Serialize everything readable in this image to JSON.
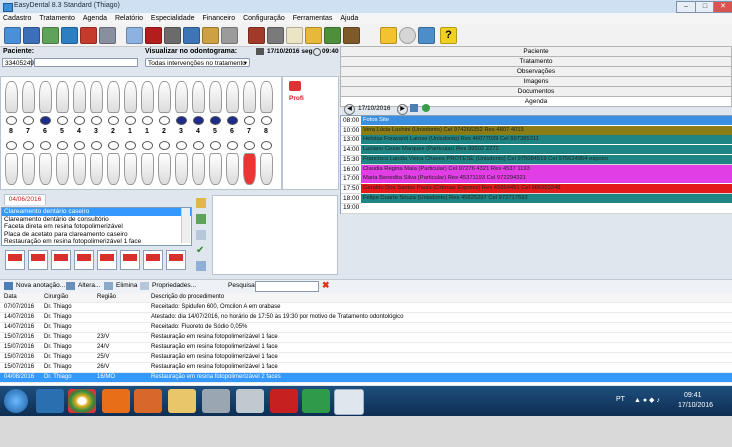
{
  "window": {
    "title": "EasyDental 8.3 Standard (Thiago)",
    "min": "–",
    "max": "□",
    "close": "✕"
  },
  "menu": [
    "Cadastro",
    "Tratamento",
    "Agenda",
    "Relatório",
    "Especialidade",
    "Financeiro",
    "Configuração",
    "Ferramentas",
    "Ajuda"
  ],
  "patient": {
    "label": "Paciente:",
    "id": "33405249",
    "name": ""
  },
  "view": {
    "label": "Visualizar no odontograma:",
    "value": "Todas intervenções no tratamento"
  },
  "header_date": {
    "date": "17/10/2016 seg",
    "time": "09:40"
  },
  "teeth_numbers": [
    "8",
    "7",
    "6",
    "5",
    "4",
    "3",
    "2",
    "1",
    "1",
    "2",
    "3",
    "4",
    "5",
    "6",
    "7",
    "8"
  ],
  "profile_label": "Profi",
  "right_tabs": [
    "Paciente",
    "Tratamento",
    "Observações",
    "Imagens",
    "Documentos",
    "Agenda"
  ],
  "agenda_date": "17/10/2016",
  "agenda": [
    {
      "time": "08:00",
      "text": "Fotos Site",
      "color": "#3b8fe0"
    },
    {
      "time": "10:00",
      "text": "Vera Lúcia Luchini (Unisdonto) Cel 974266352 Res 4807 4015",
      "color": "#8a7d16"
    },
    {
      "time": "13:00",
      "text": "Heloisa Foravanti Larose (Unisdonto) Res 46077039 Cel 997385311",
      "color": "#1f8484"
    },
    {
      "time": "14:00",
      "text": "Luciano Cezar Marques (Particular) Res 99502 2272",
      "color": "#1f8484"
    },
    {
      "time": "15:30",
      "text": "Francisca Landia Vieira Chaves PROTESE (Unisdonto) Cel 975084519 Cel 975624954 esposo",
      "color": "#1f8484"
    },
    {
      "time": "16:00",
      "text": "Claudia Regina Maia (Particular) Cel 97276 4321 Res 4537 1193",
      "color": "#e23ee6"
    },
    {
      "time": "17:00",
      "text": "Maria Benedita Silva (Particular) Res 45371193 Cel 972294321",
      "color": "#e23ee6"
    },
    {
      "time": "17:50",
      "text": "Geraldo Dos Santos Paulo (Ortonax Express) Res 45864451 Cel 986950248",
      "color": "#e31a1a"
    },
    {
      "time": "18:00",
      "text": "Felipe Duarte Souza (Unisdonto) Res 45825297 Cel 972717592",
      "color": "#1f8484"
    },
    {
      "time": "19:00",
      "text": "",
      "color": "#ffffff"
    }
  ],
  "treatment_tab": "04/06/2016",
  "procedures": [
    "Clareamento dentário caseiro",
    "Clareamento dentário de consultório",
    "Faceta direta em resina fotopolimerizável",
    "Placa de acetato para clareamento caseiro",
    "Restauração em resina fotopolimerizável 1 face"
  ],
  "actions": {
    "new": "Nova anotação...",
    "edit": "Altera...",
    "delete": "Elimina",
    "props": "Propriedades...",
    "search": "Pesquisa:"
  },
  "history_head": {
    "date": "Data",
    "surgeon": "Cirurgião",
    "region": "Região",
    "desc": "Descrição do procedimento"
  },
  "history": [
    {
      "date": "07/07/2016",
      "surgeon": "Dr. Thiago",
      "region": "",
      "desc": "Receitado: Spidufen 600, Omcilon A em orabase"
    },
    {
      "date": "14/07/2016",
      "surgeon": "Dr. Thiago",
      "region": "",
      "desc": "Atestado: dia 14/07/2016, no horário de 17:50 às 19:30 por motivo de Tratamento odontológico"
    },
    {
      "date": "14/07/2016",
      "surgeon": "Dr. Thiago",
      "region": "",
      "desc": "Receitado: Fluoreto de Sódio 0,05%"
    },
    {
      "date": "15/07/2016",
      "surgeon": "Dr. Thiago",
      "region": "23/V",
      "desc": "Restauração em resina fotopolimerizável 1 face"
    },
    {
      "date": "15/07/2016",
      "surgeon": "Dr. Thiago",
      "region": "24/V",
      "desc": "Restauração em resina fotopolimerizável 1 face"
    },
    {
      "date": "15/07/2016",
      "surgeon": "Dr. Thiago",
      "region": "25/V",
      "desc": "Restauração em resina fotopolimerizável 1 face"
    },
    {
      "date": "15/07/2016",
      "surgeon": "Dr. Thiago",
      "region": "26/V",
      "desc": "Restauração em resina fotopolimerizável 1 face"
    },
    {
      "date": "04/08/2016",
      "surgeon": "Dr. Thiago",
      "region": "16/MO",
      "desc": "Restauração em resina fotopolimerizável 2 faces"
    }
  ],
  "tray": {
    "lang": "PT",
    "time": "09:41",
    "date": "17/10/2016"
  }
}
